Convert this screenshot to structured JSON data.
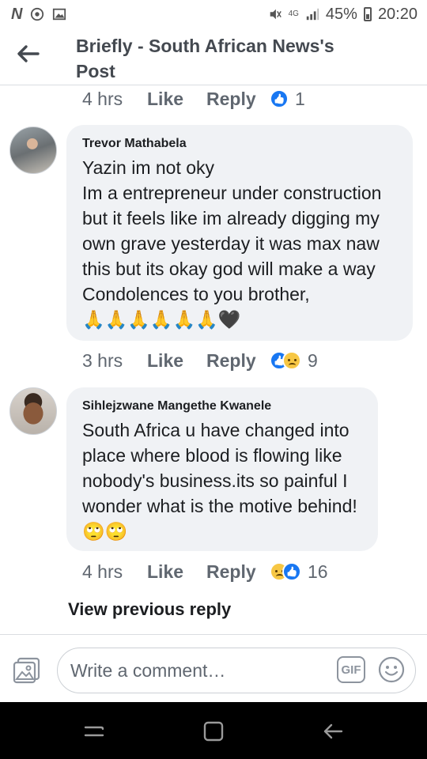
{
  "status": {
    "battery": "45%",
    "time": "20:20",
    "network": "4G"
  },
  "header": {
    "title": "Briefly - South African News's Post"
  },
  "top_meta": {
    "time": "4 hrs",
    "like": "Like",
    "reply": "Reply",
    "reaction_count": "1",
    "reactions": [
      "like-icon"
    ]
  },
  "comments": [
    {
      "name": "Trevor Mathabela",
      "text": "Yazin im not oky\nIm a entrepreneur under construction but it feels like im already digging my own grave yesterday it was max naw this but its okay god will make a way\nCondolences to you brother,\n🙏🙏🙏🙏🙏🙏🖤",
      "time": "3 hrs",
      "like": "Like",
      "reply": "Reply",
      "reaction_count": "9",
      "reactions": [
        "like-icon",
        "sad-icon"
      ]
    },
    {
      "name": "Sihlejzwane Mangethe Kwanele",
      "text": "South Africa u have changed into place where blood is flowing like nobody's business.its so painful I wonder what is the motive behind!🙄🙄",
      "time": "4 hrs",
      "like": "Like",
      "reply": "Reply",
      "reaction_count": "16",
      "reactions": [
        "sad-icon",
        "like-icon"
      ]
    }
  ],
  "view_previous": "View previous reply",
  "composer": {
    "placeholder": "Write a comment…",
    "gif_label": "GIF"
  },
  "colors": {
    "like_blue": "#1877f2",
    "bubble_bg": "#f0f2f5",
    "meta_gray": "#606770"
  }
}
